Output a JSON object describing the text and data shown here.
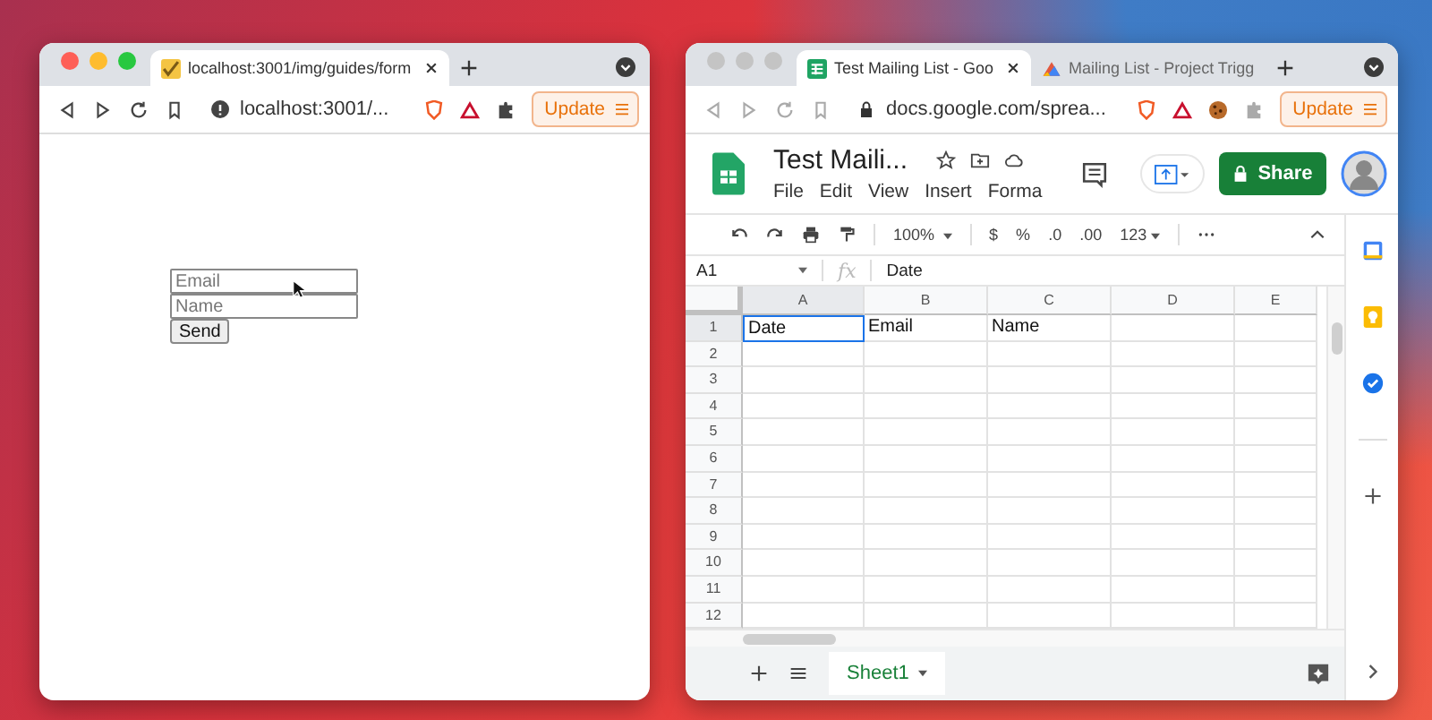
{
  "windows": [
    {
      "kind": "form-page",
      "active": true,
      "tabs": [
        {
          "title": "localhost:3001/img/guides/form",
          "selected": true
        }
      ],
      "address": "localhost:3001/...",
      "secure": false,
      "update_label": "Update",
      "form": {
        "fields": [
          {
            "placeholder": "Email"
          },
          {
            "placeholder": "Name"
          }
        ],
        "submit": "Send"
      }
    },
    {
      "kind": "spreadsheet",
      "active": false,
      "tabs": [
        {
          "title": "Test Mailing List - Goo",
          "selected": true
        },
        {
          "title": "Mailing List - Project Trigg",
          "selected": false
        }
      ],
      "address": "docs.google.com/sprea...",
      "secure": true,
      "update_label": "Update",
      "sheet": {
        "title": "Test Maili...",
        "menu": [
          "File",
          "Edit",
          "View",
          "Insert",
          "Forma"
        ],
        "share_label": "Share",
        "toolbar": {
          "zoom": "100%",
          "currency": "$",
          "percent": "%",
          "decimal_decrease": ".0",
          "decimal_increase": ".00",
          "number_format": "123"
        },
        "name_box": "A1",
        "fx_label": "fx",
        "formula": "Date",
        "columns": [
          {
            "label": "A",
            "selected": true
          },
          {
            "label": "B",
            "selected": false
          },
          {
            "label": "C",
            "selected": false
          },
          {
            "label": "D",
            "selected": false
          },
          {
            "label": "E",
            "selected": false
          }
        ],
        "rows": [
          {
            "number": "1",
            "selected": true,
            "cells": [
              {
                "text": "Date",
                "selected": true
              },
              {
                "text": "Email",
                "selected": false
              },
              {
                "text": "Name",
                "selected": false
              }
            ]
          },
          {
            "number": "2",
            "selected": false
          },
          {
            "number": "3",
            "selected": false
          },
          {
            "number": "4",
            "selected": false
          },
          {
            "number": "5",
            "selected": false
          },
          {
            "number": "6",
            "selected": false
          },
          {
            "number": "7",
            "selected": false
          },
          {
            "number": "8",
            "selected": false
          },
          {
            "number": "9",
            "selected": false
          },
          {
            "number": "10",
            "selected": false
          },
          {
            "number": "11",
            "selected": false
          },
          {
            "number": "12",
            "selected": false
          }
        ],
        "sheet_tabs": [
          {
            "label": "Sheet1",
            "selected": true
          }
        ]
      }
    }
  ]
}
